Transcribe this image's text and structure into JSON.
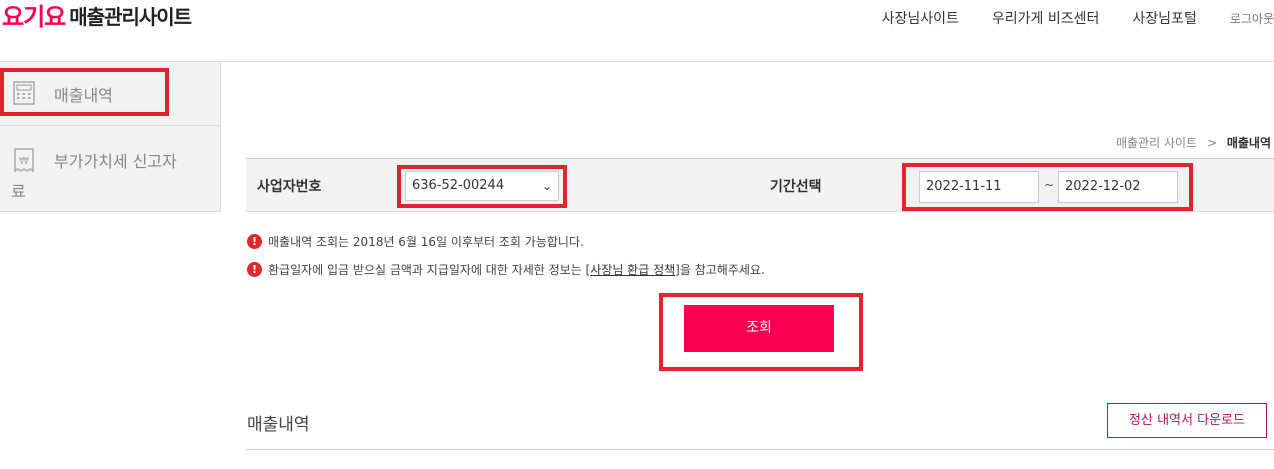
{
  "logo": {
    "brand": "요기요",
    "subtitle": "매출관리사이트"
  },
  "topnav": {
    "items": [
      "사장님사이트",
      "우리가게 비즈센터",
      "사장님포털"
    ],
    "logout": "로그아웃"
  },
  "sidebar": {
    "items": [
      {
        "label": "매출내역",
        "icon": "calculator-icon"
      },
      {
        "label": "부가가치세 신고자",
        "label_cont": "료",
        "icon": "won-receipt-icon"
      }
    ]
  },
  "breadcrumb": {
    "parent": "매출관리 사이트",
    "separator": ">",
    "current": "매출내역"
  },
  "search": {
    "biz_label": "사업자번호",
    "biz_value": "636-52-00244",
    "period_label": "기간선택",
    "start_date": "2022-11-11",
    "end_date": "2022-12-02",
    "tilde": "~"
  },
  "notices": {
    "n1": "매출내역 조회는 2018년 6월 16일 이후부터 조회 가능합니다.",
    "n2_pre": "환급일자에 입금 받으실 금액과 지급일자에 대한 자세한 정보는 [",
    "n2_link": "사장님 환급 정책",
    "n2_post": "]을 참고해주세요."
  },
  "search_button": "조회",
  "sales": {
    "title": "매출내역",
    "download_button": "정산 내역서 다운로드"
  },
  "colors": {
    "brand": "#fa0050",
    "highlight": "#e0262a",
    "download": "#b0185a"
  }
}
